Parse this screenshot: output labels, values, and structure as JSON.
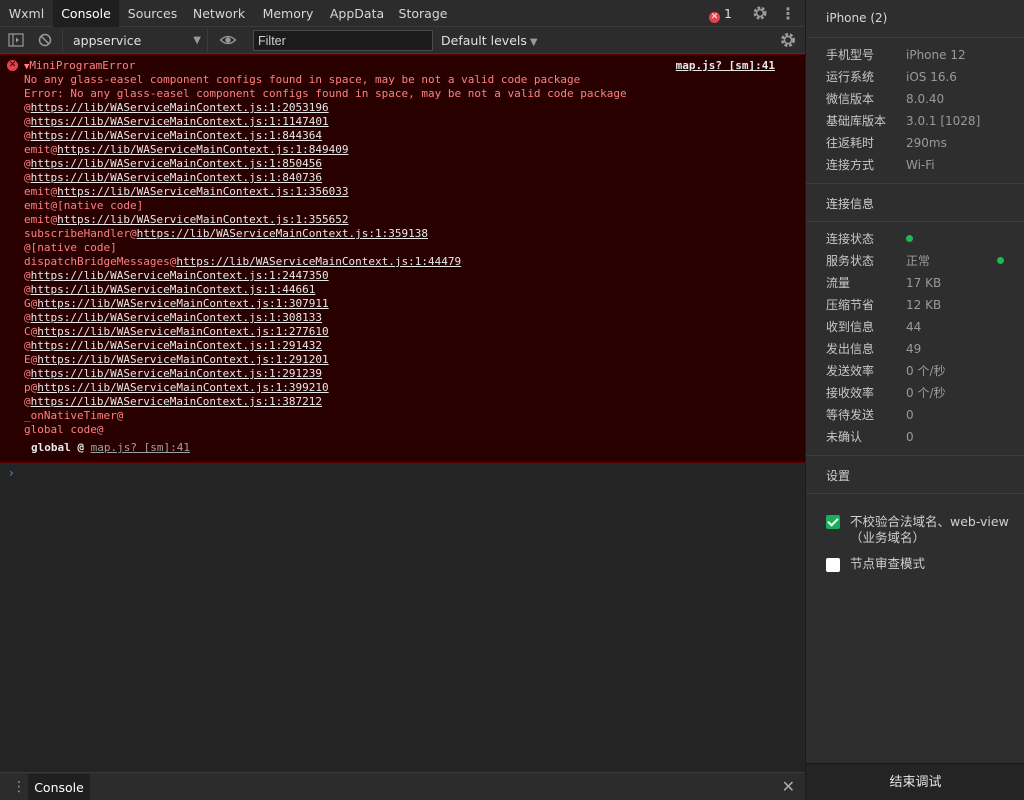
{
  "tabs": [
    "Wxml",
    "Console",
    "Sources",
    "Network",
    "Memory",
    "AppData",
    "Storage"
  ],
  "active_tab": "Console",
  "error_count": "1",
  "toolbar": {
    "context": "appservice",
    "filter_placeholder": "Filter",
    "levels": "Default levels"
  },
  "error": {
    "title": "MiniProgramError",
    "source_link": "map.js? [sm]:41",
    "lines": [
      {
        "pre": "No any glass-easel component configs found in space, may be not a valid code package",
        "url": ""
      },
      {
        "pre": "Error: No any glass-easel component configs found in space, may be not a valid code package",
        "url": ""
      },
      {
        "pre": "@",
        "url": "https://lib/WAServiceMainContext.js:1:2053196"
      },
      {
        "pre": "@",
        "url": "https://lib/WAServiceMainContext.js:1:1147401"
      },
      {
        "pre": "@",
        "url": "https://lib/WAServiceMainContext.js:1:844364"
      },
      {
        "pre": "emit@",
        "url": "https://lib/WAServiceMainContext.js:1:849409"
      },
      {
        "pre": "@",
        "url": "https://lib/WAServiceMainContext.js:1:850456"
      },
      {
        "pre": "@",
        "url": "https://lib/WAServiceMainContext.js:1:840736"
      },
      {
        "pre": "emit@",
        "url": "https://lib/WAServiceMainContext.js:1:356033"
      },
      {
        "pre": "emit@[native code]",
        "url": ""
      },
      {
        "pre": "emit@",
        "url": "https://lib/WAServiceMainContext.js:1:355652"
      },
      {
        "pre": "subscribeHandler@",
        "url": "https://lib/WAServiceMainContext.js:1:359138"
      },
      {
        "pre": "@[native code]",
        "url": ""
      },
      {
        "pre": "dispatchBridgeMessages@",
        "url": "https://lib/WAServiceMainContext.js:1:44479"
      },
      {
        "pre": "@",
        "url": "https://lib/WAServiceMainContext.js:1:2447350"
      },
      {
        "pre": "@",
        "url": "https://lib/WAServiceMainContext.js:1:44661"
      },
      {
        "pre": "G@",
        "url": "https://lib/WAServiceMainContext.js:1:307911"
      },
      {
        "pre": "@",
        "url": "https://lib/WAServiceMainContext.js:1:308133"
      },
      {
        "pre": "C@",
        "url": "https://lib/WAServiceMainContext.js:1:277610"
      },
      {
        "pre": "@",
        "url": "https://lib/WAServiceMainContext.js:1:291432"
      },
      {
        "pre": "E@",
        "url": "https://lib/WAServiceMainContext.js:1:291201"
      },
      {
        "pre": "@",
        "url": "https://lib/WAServiceMainContext.js:1:291239"
      },
      {
        "pre": "p@",
        "url": "https://lib/WAServiceMainContext.js:1:399210"
      },
      {
        "pre": "@",
        "url": "https://lib/WAServiceMainContext.js:1:387212"
      },
      {
        "pre": "_onNativeTimer@",
        "url": ""
      },
      {
        "pre": "global code@",
        "url": ""
      }
    ],
    "global_label": "global @",
    "global_link": "map.js? [sm]:41"
  },
  "drawer": {
    "tab": "Console"
  },
  "panel": {
    "device": "iPhone (2)",
    "device_info": [
      {
        "k": "手机型号",
        "v": "iPhone 12"
      },
      {
        "k": "运行系统",
        "v": "iOS 16.6"
      },
      {
        "k": "微信版本",
        "v": "8.0.40"
      },
      {
        "k": "基础库版本",
        "v": "3.0.1 [1028]"
      },
      {
        "k": "往返耗时",
        "v": "290ms"
      },
      {
        "k": "连接方式",
        "v": "Wi-Fi"
      }
    ],
    "conn_title": "连接信息",
    "conn_info": [
      {
        "k": "连接状态",
        "v": ""
      },
      {
        "k": "服务状态",
        "v": "正常"
      },
      {
        "k": "流量",
        "v": "17 KB"
      },
      {
        "k": "压缩节省",
        "v": "12 KB"
      },
      {
        "k": "收到信息",
        "v": "44"
      },
      {
        "k": "发出信息",
        "v": "49"
      },
      {
        "k": "发送效率",
        "v": "0 个/秒"
      },
      {
        "k": "接收效率",
        "v": "0 个/秒"
      },
      {
        "k": "等待发送",
        "v": "0"
      },
      {
        "k": "未确认",
        "v": "0"
      }
    ],
    "settings_title": "设置",
    "option_domain": "不校验合法域名、web-view（业务域名）",
    "option_domain_checked": true,
    "option_audit": "节点审查模式",
    "option_audit_checked": false,
    "end_button": "结束调试"
  },
  "colors": {
    "status_ok": "#1db954",
    "error_bg": "#290000",
    "error_text": "#ff8080"
  }
}
